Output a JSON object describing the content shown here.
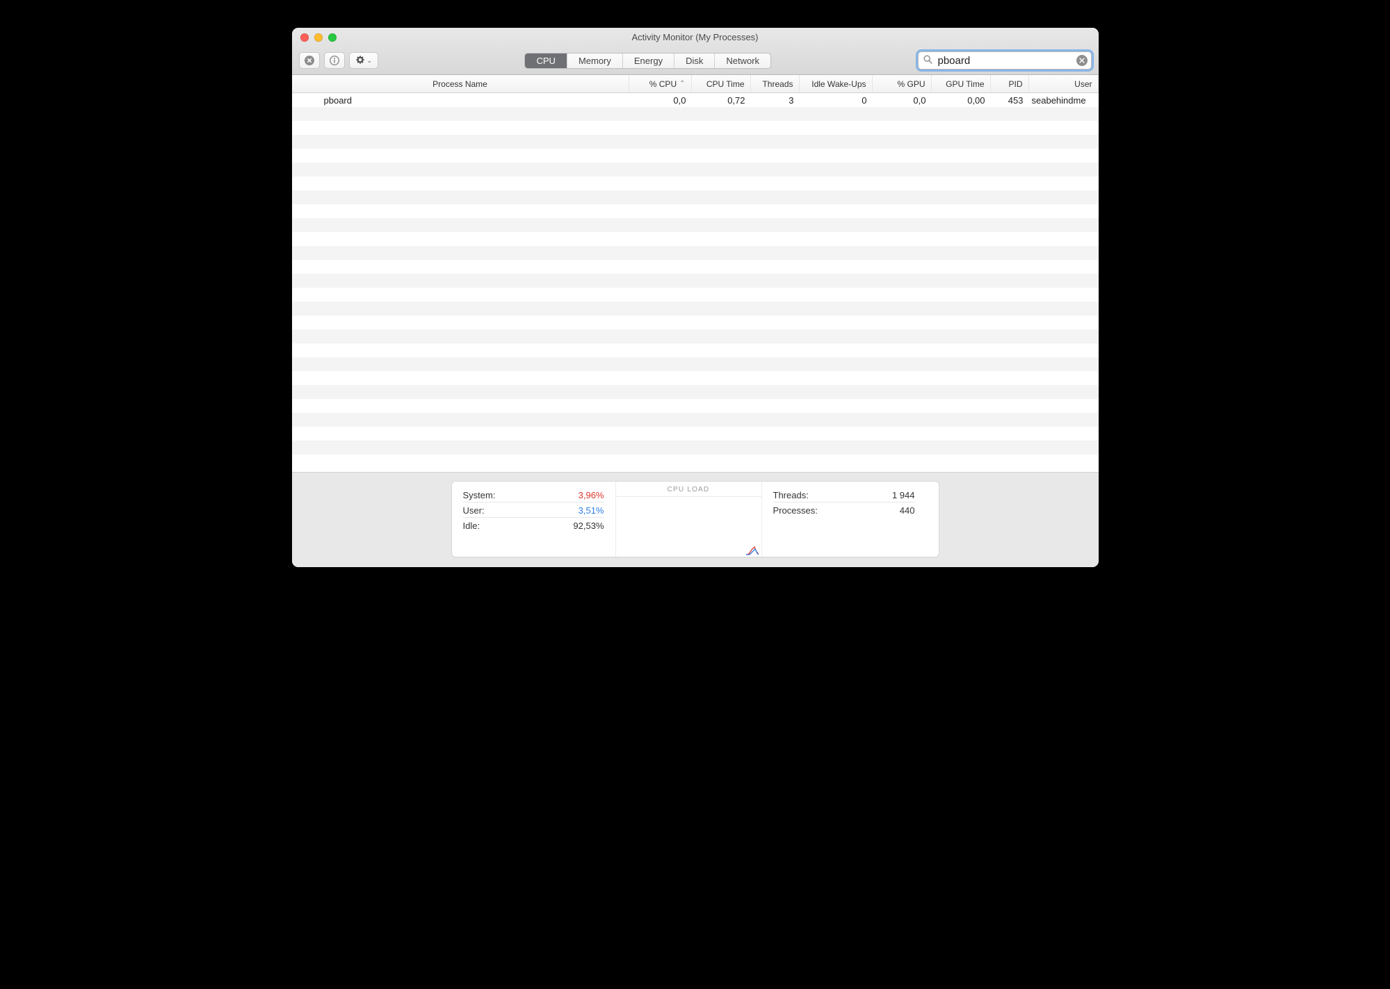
{
  "window": {
    "title": "Activity Monitor (My Processes)"
  },
  "toolbar": {
    "stop_label": "Stop",
    "info_label": "Info",
    "actions_label": "Actions"
  },
  "tabs": [
    {
      "label": "CPU",
      "active": true
    },
    {
      "label": "Memory",
      "active": false
    },
    {
      "label": "Energy",
      "active": false
    },
    {
      "label": "Disk",
      "active": false
    },
    {
      "label": "Network",
      "active": false
    }
  ],
  "search": {
    "value": "pboard"
  },
  "columns": {
    "name": "Process Name",
    "cpu": "% CPU",
    "cputime": "CPU Time",
    "threads": "Threads",
    "idle": "Idle Wake-Ups",
    "gpu": "% GPU",
    "gputime": "GPU Time",
    "pid": "PID",
    "user": "User",
    "sort": "cpu_asc"
  },
  "rows": [
    {
      "name": "pboard",
      "cpu": "0,0",
      "cputime": "0,72",
      "threads": "3",
      "idle": "0",
      "gpu": "0,0",
      "gputime": "0,00",
      "pid": "453",
      "user": "seabehindme"
    }
  ],
  "footer": {
    "system_label": "System:",
    "system_value": "3,96%",
    "user_label": "User:",
    "user_value": "3,51%",
    "idle_label": "Idle:",
    "idle_value": "92,53%",
    "cpu_load_label": "CPU LOAD",
    "threads_label": "Threads:",
    "threads_value": "1 944",
    "processes_label": "Processes:",
    "processes_value": "440"
  },
  "colors": {
    "system": "#e0352b",
    "user": "#2f7ee6",
    "accent_focus": "#88b5e6"
  }
}
